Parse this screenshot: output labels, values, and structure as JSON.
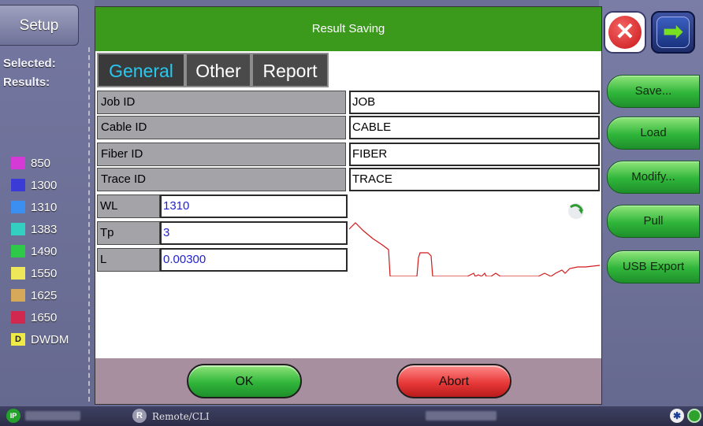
{
  "left_panel": {
    "setup_label": "Setup",
    "selected_label": "Selected:",
    "results_label": "Results:",
    "wavelengths": [
      {
        "label": "850",
        "color": "#d63ad6"
      },
      {
        "label": "1300",
        "color": "#3b3bd8"
      },
      {
        "label": "1310",
        "color": "#3a8ff0"
      },
      {
        "label": "1383",
        "color": "#33cfc0"
      },
      {
        "label": "1490",
        "color": "#2fc94a"
      },
      {
        "label": "1550",
        "color": "#efe75a"
      },
      {
        "label": "1625",
        "color": "#d6a95a"
      },
      {
        "label": "1650",
        "color": "#d0284f"
      }
    ],
    "dwdm_badge": "D",
    "dwdm_label": "DWDM"
  },
  "dialog": {
    "title": "Result Saving",
    "tabs": [
      {
        "label": "General",
        "active": true
      },
      {
        "label": "Other",
        "active": false
      },
      {
        "label": "Report",
        "active": false
      }
    ],
    "fields": [
      {
        "label": "Job ID",
        "value": "JOB"
      },
      {
        "label": "Cable ID",
        "value": "CABLE"
      },
      {
        "label": "Fiber ID",
        "value": "FIBER"
      },
      {
        "label": "Trace ID",
        "value": "TRACE"
      }
    ],
    "params": [
      {
        "label": "WL",
        "value": "1310"
      },
      {
        "label": "Tp",
        "value": "3"
      },
      {
        "label": "L",
        "value": "0.00300"
      }
    ],
    "refresh_icon": "refresh-arrow-icon",
    "ok_label": "OK",
    "abort_label": "Abort"
  },
  "right_panel": {
    "close_icon": "close-icon",
    "next_icon": "next-arrow-icon",
    "buttons": [
      "Save...",
      "Load",
      "Modify...",
      "Pull",
      "USB Export"
    ]
  },
  "status_bar": {
    "ip_badge": "IP",
    "remote_badge": "R",
    "remote_label": "Remote/CLI"
  },
  "colors": {
    "title_bar": "#3b9a1c",
    "active_tab_text": "#28c8f0",
    "param_value_text": "#2222cc",
    "trace": "#d11919"
  }
}
